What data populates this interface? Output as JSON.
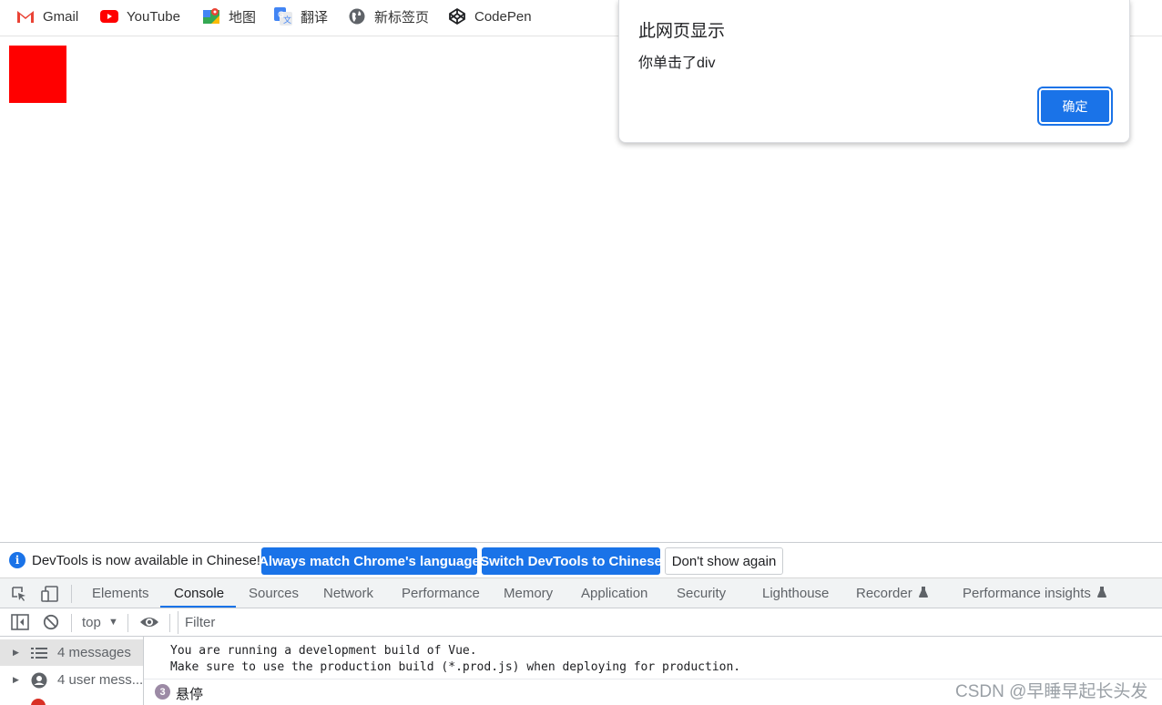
{
  "bookmarks": {
    "items": [
      {
        "label": "Gmail",
        "icon": "gmail-icon"
      },
      {
        "label": "YouTube",
        "icon": "youtube-icon"
      },
      {
        "label": "地图",
        "icon": "maps-icon"
      },
      {
        "label": "翻译",
        "icon": "translate-icon"
      },
      {
        "label": "新标签页",
        "icon": "globe-icon"
      },
      {
        "label": "CodePen",
        "icon": "codepen-icon"
      }
    ]
  },
  "page": {
    "box_color": "#ff0000"
  },
  "dialog": {
    "title": "此网页显示",
    "message": "你单击了div",
    "ok_label": "确定"
  },
  "devtools": {
    "infobar": {
      "text": "DevTools is now available in Chinese!",
      "btn_match": "Always match Chrome's language",
      "btn_switch": "Switch DevTools to Chinese",
      "btn_dismiss": "Don't show again"
    },
    "tabs": [
      {
        "label": "Elements"
      },
      {
        "label": "Console",
        "active": true
      },
      {
        "label": "Sources"
      },
      {
        "label": "Network"
      },
      {
        "label": "Performance"
      },
      {
        "label": "Memory"
      },
      {
        "label": "Application"
      },
      {
        "label": "Security"
      },
      {
        "label": "Lighthouse"
      },
      {
        "label": "Recorder",
        "experimental": true
      },
      {
        "label": "Performance insights",
        "experimental": true
      }
    ],
    "console": {
      "context": "top",
      "filter_placeholder": "Filter",
      "sidebar": [
        {
          "label": "4 messages",
          "icon": "list-icon",
          "selected": true
        },
        {
          "label": "4 user mess...",
          "icon": "user-icon"
        }
      ],
      "log_lines": [
        "You are running a development build of Vue.",
        "Make sure to use the production build (*.prod.js) when deploying for production."
      ],
      "repeat_count": "3",
      "repeat_text": "悬停"
    }
  },
  "watermark": "CSDN @早睡早起长头发",
  "colors": {
    "accent": "#1a73e8",
    "error": "#d93025"
  }
}
